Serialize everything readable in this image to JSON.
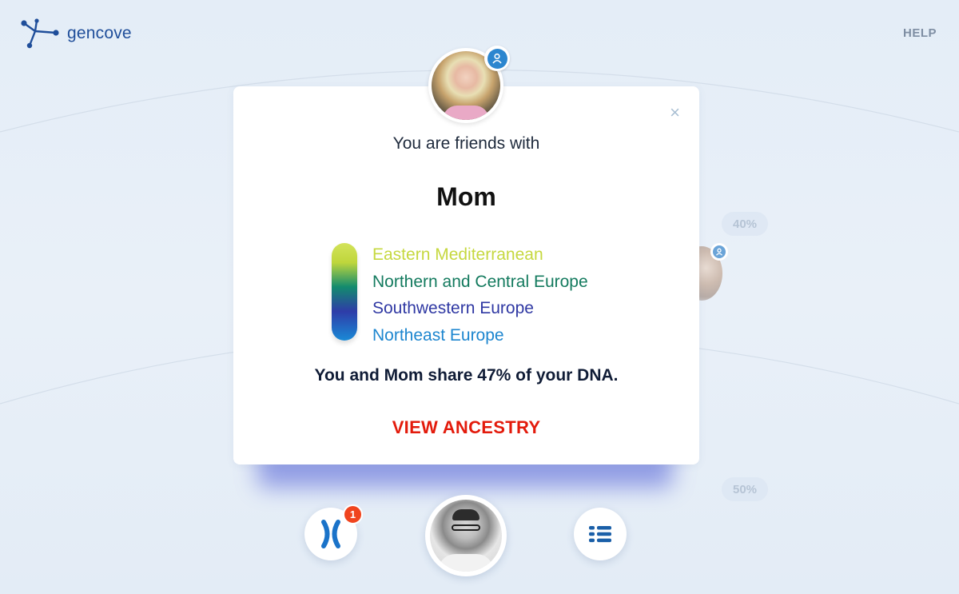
{
  "app": {
    "logo_text": "gencove",
    "help_label": "HELP"
  },
  "background": {
    "ring_labels": [
      "40%",
      "50%"
    ]
  },
  "modal": {
    "close_symbol": "×",
    "friend_label": "You are friends with",
    "friend_name": "Mom",
    "ancestry_regions": [
      {
        "name": "Eastern Mediterranean",
        "color": "#c6d83f"
      },
      {
        "name": "Northern and Central Europe",
        "color": "#137a5e"
      },
      {
        "name": "Southwestern Europe",
        "color": "#2f38a3"
      },
      {
        "name": "Northeast Europe",
        "color": "#1d86cf"
      }
    ],
    "share_text": "You and Mom share 47% of your DNA.",
    "share_percent": 47,
    "view_ancestry_label": "VIEW ANCESTRY"
  },
  "bottom_bar": {
    "dna_notification_count": "1",
    "icons": [
      "dna-chromosome-icon",
      "user-avatar",
      "list-icon"
    ]
  },
  "colors": {
    "accent_red": "#e31b0c",
    "brand_blue": "#1f4e9a",
    "badge_blue": "#2c86cf",
    "notification": "#f0441e"
  }
}
